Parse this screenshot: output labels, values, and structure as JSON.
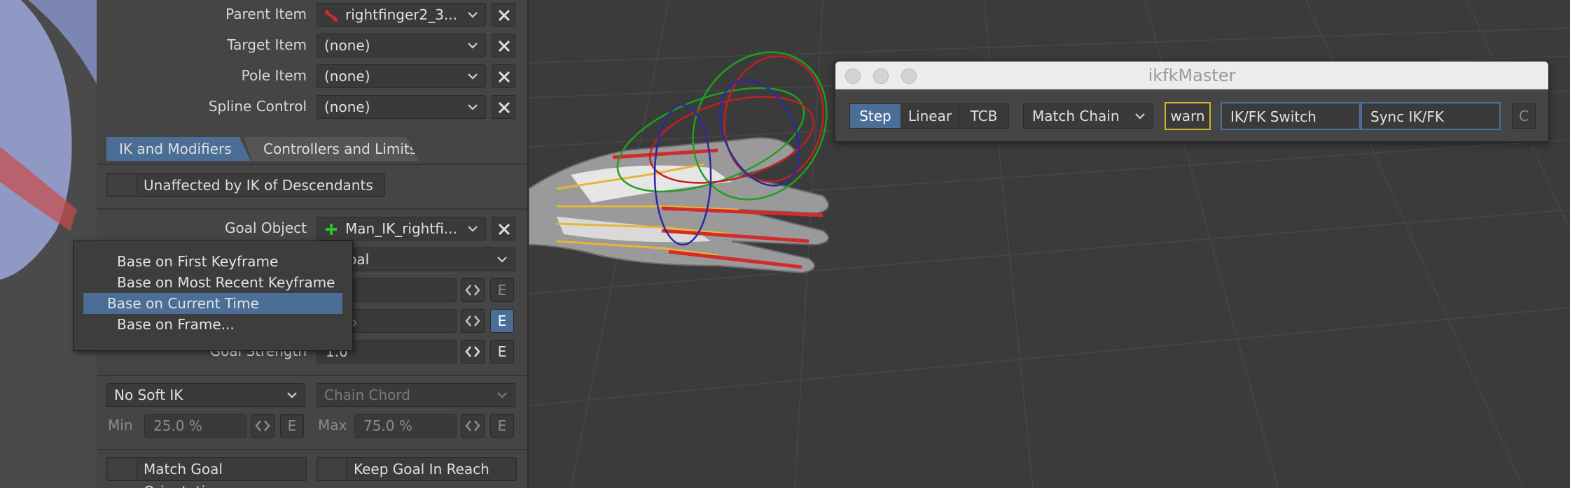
{
  "panel": {
    "rows": [
      {
        "label": "Parent Item",
        "value": "rightfinger2_3...",
        "icon": "bone-icon"
      },
      {
        "label": "Target Item",
        "value": "(none)"
      },
      {
        "label": "Pole Item",
        "value": "(none)"
      },
      {
        "label": "Spline Control",
        "value": "(none)"
      }
    ],
    "tabs": {
      "active": "IK and Modifiers",
      "inactive": "Controllers and Limits"
    },
    "unaffected_label": "Unaffected by IK of Descendants",
    "goal_object": {
      "label": "Goal Object",
      "value": "Man_IK_rightfi..."
    },
    "goal_mode_value": "o Goal",
    "field_pct": ".0 %",
    "goal_strength": {
      "label": "Goal Strength",
      "value": "1.0"
    },
    "soft_ik": {
      "value": "No Soft IK",
      "chain_value": "Chain Chord"
    },
    "min": {
      "label": "Min",
      "value": "25.0 %"
    },
    "max": {
      "label": "Max",
      "value": "75.0 %"
    },
    "e_label": "E",
    "match_goal_label": "Match Goal Orientation",
    "keep_goal_label": "Keep Goal In Reach"
  },
  "context_menu": {
    "items": [
      {
        "label": "Base on First Keyframe",
        "selected": false
      },
      {
        "label": "Base on Most Recent Keyframe",
        "selected": false
      },
      {
        "label": "Base on Current Time",
        "selected": true
      },
      {
        "label": "Base on Frame...",
        "selected": false
      }
    ]
  },
  "dialog": {
    "title": "ikfkMaster",
    "interp_buttons": [
      "Step",
      "Linear",
      "TCB"
    ],
    "active_interp": "Step",
    "chain_dropdown": "Match Chain",
    "warn": "warn",
    "ikfk_switch": "IK/FK Switch",
    "sync": "Sync IK/FK",
    "last_button": "C"
  },
  "colors": {
    "accent": "#4b6e97",
    "warn_border": "#c9b431",
    "bone_red": "#d42a2a",
    "null_green": "#2fbf2f",
    "panel_bg": "#454545"
  }
}
